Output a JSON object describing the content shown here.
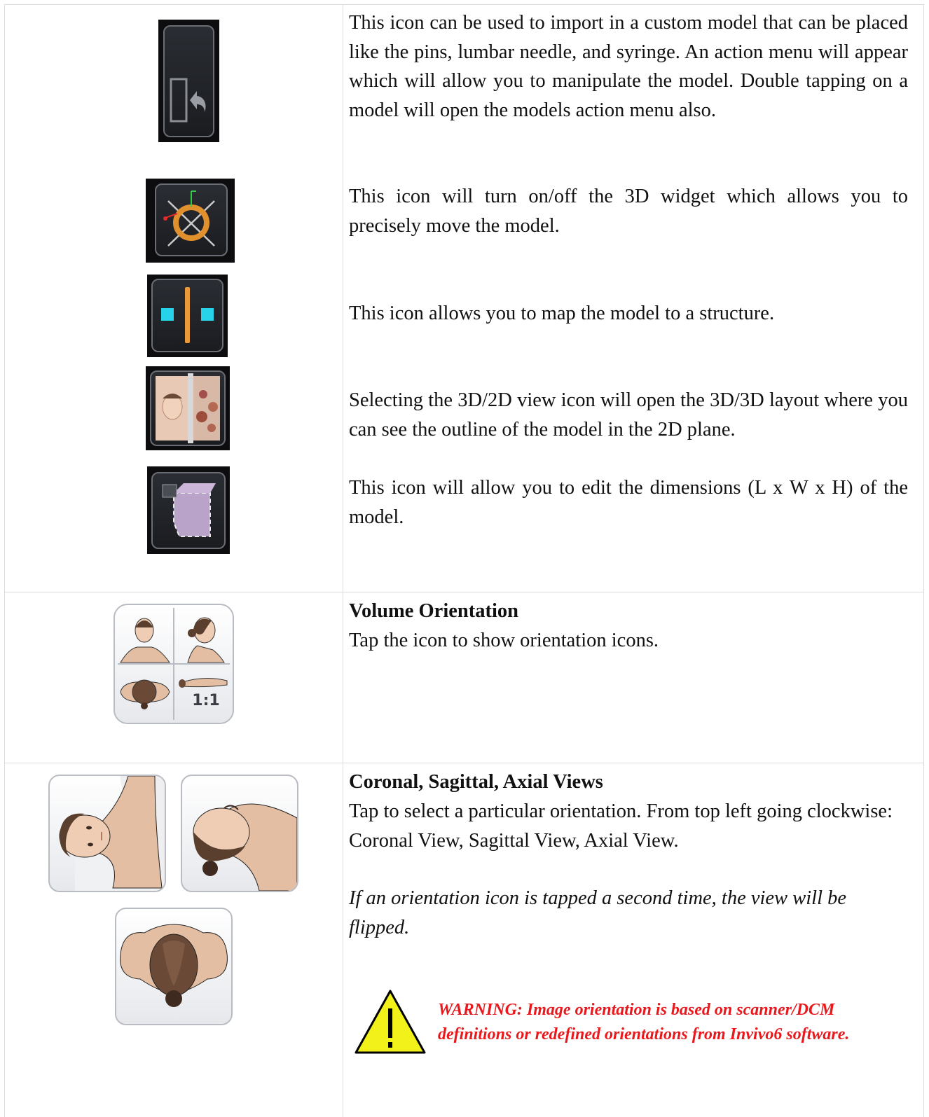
{
  "rows": {
    "model_tools": {
      "import_text": "This icon can be used to import in a custom model that can be placed like the pins, lumbar needle, and syringe. An action menu will appear which will allow you to manipulate the model. Double tapping on a model will open the models action menu also.",
      "widget_text": "This icon will turn on/off the 3D widget which allows you to precisely move the model.",
      "map_text": "This icon allows you to map the model to a structure.",
      "view_text": "Selecting the 3D/2D view icon will open the 3D/3D layout where you can see the outline of the model in the 2D plane.",
      "dimensions_text": "This icon will allow you to edit the dimensions (L x W x H) of the model."
    },
    "volume_orientation": {
      "title": "Volume Orientation",
      "text": "Tap the icon to show orientation icons.",
      "ratio_label": "1:1"
    },
    "views": {
      "title": "Coronal, Sagittal, Axial Views",
      "text": "Tap to select a particular orientation. From top left going clockwise: Coronal View, Sagittal View, Axial View.",
      "note": "If an orientation icon is tapped a second time, the view will be flipped.",
      "warning_line1": "WARNING: Image orientation is based on scanner/DCM",
      "warning_line2": "definitions or redefined orientations from Invivo6 software."
    }
  },
  "icons": [
    "import-model-icon",
    "widget-3d-icon",
    "map-structure-icon",
    "view-3d-2d-icon",
    "edit-dimensions-icon",
    "volume-orientation-icon",
    "coronal-view-icon",
    "sagittal-view-icon",
    "axial-view-icon",
    "warning-icon"
  ],
  "colors": {
    "warning_text": "#e8181c",
    "warning_fill": "#f2f21a",
    "cyan_marker": "#27d3e8",
    "orange_bar": "#e89a3a",
    "purple_box": "#b9a3c9"
  }
}
